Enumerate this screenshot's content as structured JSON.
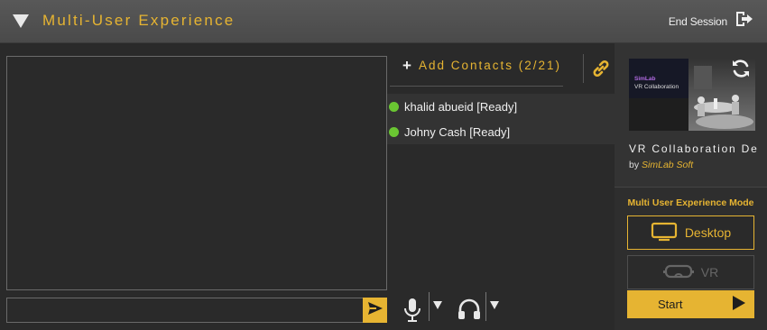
{
  "header": {
    "title": "Multi-User Experience",
    "collapse_icon": "triangle-down-icon",
    "end_session_label": "End Session",
    "end_session_icon": "exit-icon"
  },
  "chat": {
    "input_value": "",
    "input_placeholder": "",
    "send_icon": "send-icon"
  },
  "contacts": {
    "add_label": "Add Contacts",
    "count": "(2/21)",
    "link_icon": "link-icon",
    "items": [
      {
        "name": "khalid abueid",
        "status": "[Ready]"
      },
      {
        "name": "Johny Cash",
        "status": "[Ready]"
      }
    ]
  },
  "audio": {
    "mic_icon": "microphone-icon",
    "headphones_icon": "headphones-icon"
  },
  "product": {
    "thumb_brand": "SimLab",
    "thumb_subtitle": "VR Collaboration",
    "title": "VR Collaboration De",
    "by_label": "by",
    "vendor": "SimLab Soft",
    "sync_icon": "sync-icon"
  },
  "mode": {
    "title": "Multi User Experience Mode",
    "desktop_label": "Desktop",
    "vr_label": "VR",
    "selected": "Desktop",
    "start_label": "Start"
  },
  "colors": {
    "accent": "#e6b432",
    "ready": "#6ac632",
    "panel": "#2a2a2a"
  }
}
